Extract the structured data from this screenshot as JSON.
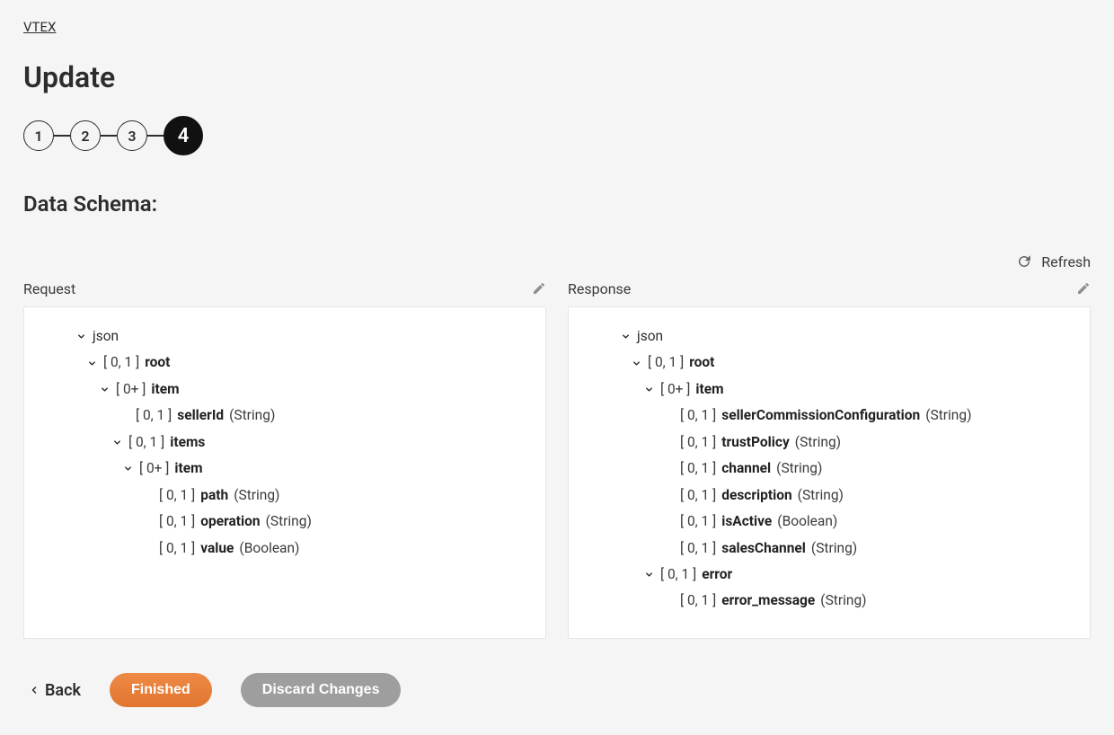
{
  "brand": "VTEX",
  "title": "Update",
  "steps": [
    "1",
    "2",
    "3",
    "4"
  ],
  "active_step_index": 3,
  "section_label": "Data Schema:",
  "refresh_label": "Refresh",
  "panels": {
    "request_label": "Request",
    "response_label": "Response"
  },
  "footer": {
    "back": "Back",
    "finished": "Finished",
    "discard": "Discard Changes"
  },
  "schema": {
    "request": {
      "json": "json",
      "root": {
        "card": "[ 0, 1 ]",
        "name": "root"
      },
      "item": {
        "card": "[ 0+ ]",
        "name": "item"
      },
      "sellerId": {
        "card": "[ 0, 1 ]",
        "name": "sellerId",
        "type": "(String)"
      },
      "items": {
        "card": "[ 0, 1 ]",
        "name": "items"
      },
      "inner_item": {
        "card": "[ 0+ ]",
        "name": "item"
      },
      "path": {
        "card": "[ 0, 1 ]",
        "name": "path",
        "type": "(String)"
      },
      "operation": {
        "card": "[ 0, 1 ]",
        "name": "operation",
        "type": "(String)"
      },
      "value": {
        "card": "[ 0, 1 ]",
        "name": "value",
        "type": "(Boolean)"
      }
    },
    "response": {
      "json": "json",
      "root": {
        "card": "[ 0, 1 ]",
        "name": "root"
      },
      "item": {
        "card": "[ 0+ ]",
        "name": "item"
      },
      "sellerCommissionConfiguration": {
        "card": "[ 0, 1 ]",
        "name": "sellerCommissionConfiguration",
        "type": "(String)"
      },
      "trustPolicy": {
        "card": "[ 0, 1 ]",
        "name": "trustPolicy",
        "type": "(String)"
      },
      "channel": {
        "card": "[ 0, 1 ]",
        "name": "channel",
        "type": "(String)"
      },
      "description": {
        "card": "[ 0, 1 ]",
        "name": "description",
        "type": "(String)"
      },
      "isActive": {
        "card": "[ 0, 1 ]",
        "name": "isActive",
        "type": "(Boolean)"
      },
      "salesChannel": {
        "card": "[ 0, 1 ]",
        "name": "salesChannel",
        "type": "(String)"
      },
      "error": {
        "card": "[ 0, 1 ]",
        "name": "error"
      },
      "error_message": {
        "card": "[ 0, 1 ]",
        "name": "error_message",
        "type": "(String)"
      }
    }
  }
}
